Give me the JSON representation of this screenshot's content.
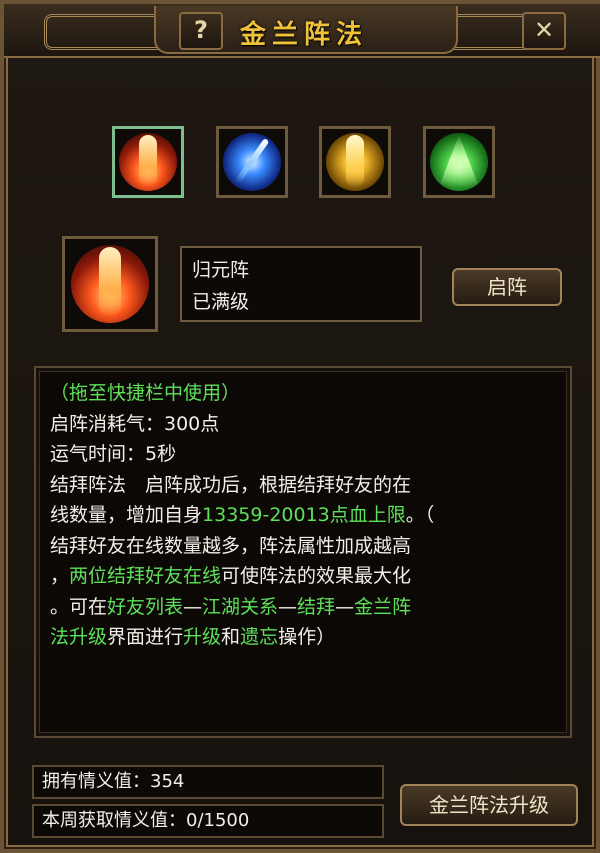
{
  "window": {
    "title": "金兰阵法",
    "help_label": "?",
    "close_label": "✕"
  },
  "formations": [
    {
      "name": "red-formation-icon",
      "color": "#ff5a1e"
    },
    {
      "name": "blue-formation-icon",
      "color": "#3a8cff"
    },
    {
      "name": "gold-formation-icon",
      "color": "#e8b028"
    },
    {
      "name": "green-formation-icon",
      "color": "#4fd04a"
    }
  ],
  "selected": {
    "name": "归元阵",
    "level": "已满级",
    "activate_label": "启阵"
  },
  "description": {
    "hint": "（拖至快捷栏中使用）",
    "cost": "启阵消耗气：300点",
    "duration": "运气时间：5秒",
    "line4": "结拜阵法　启阵成功后，根据结拜好友的在",
    "line5_a": "线数量，增加自身",
    "line5_b": "13359-20013点血上限",
    "line5_c": "。（",
    "line6": "结拜好友在线数量越多，阵法属性加成越高",
    "line7_a": "，",
    "line7_b": "两位结拜好友在线",
    "line7_c": "可使阵法的效果最大化",
    "line8_a": "。可在",
    "line8_b": "好友列表",
    "line8_c": "—",
    "line8_d": "江湖关系",
    "line8_e": "—",
    "line8_f": "结拜",
    "line8_g": "—",
    "line8_h": "金兰阵",
    "line9_a": "法升级",
    "line9_b": "界面进行",
    "line9_c": "升级",
    "line9_d": "和",
    "line9_e": "遗忘",
    "line9_f": "操作）"
  },
  "stats": {
    "owned": "拥有情义值：354",
    "weekly": "本周获取情义值：0/1500"
  },
  "upgrade_label": "金兰阵法升级",
  "colors": {
    "title": "#f0c23a",
    "highlight": "#5fe05a",
    "text": "#f2efe6"
  }
}
